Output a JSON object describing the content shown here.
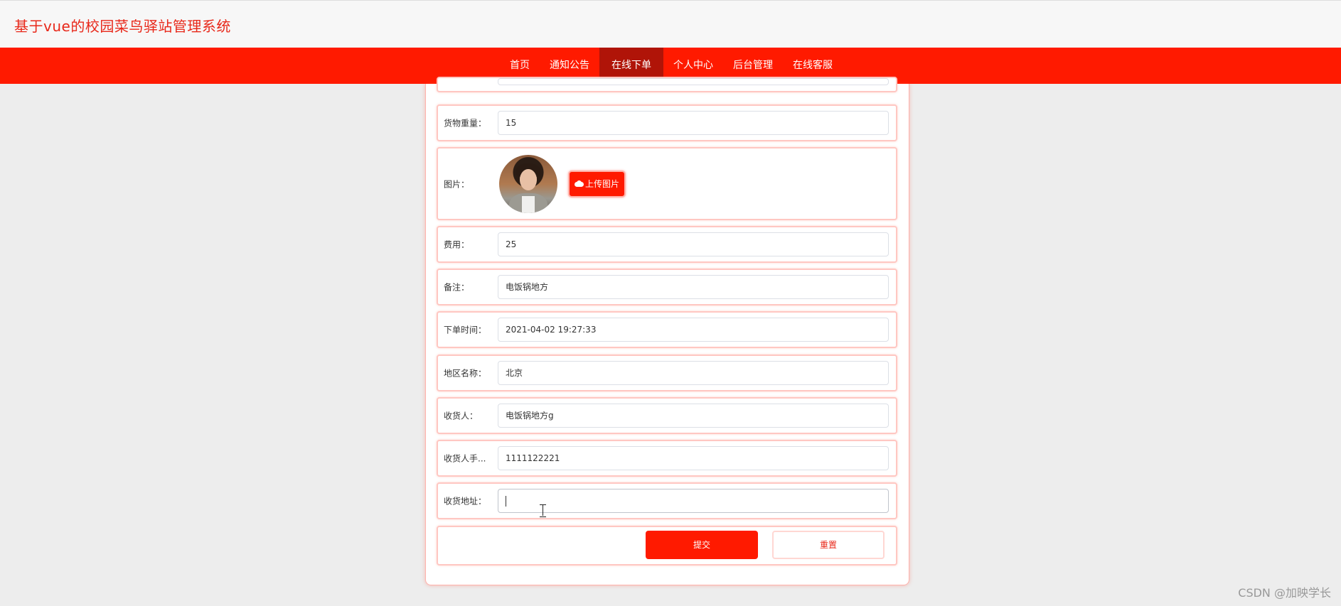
{
  "header": {
    "site_title": "基于vue的校园菜鸟驿站管理系统"
  },
  "nav": {
    "items": [
      {
        "label": "首页"
      },
      {
        "label": "通知公告"
      },
      {
        "label": "在线下单"
      },
      {
        "label": "个人中心"
      },
      {
        "label": "后台管理"
      },
      {
        "label": "在线客服"
      }
    ],
    "active": "在线下单"
  },
  "form": {
    "weight": {
      "label": "货物重量：",
      "value": "15"
    },
    "image": {
      "label": "图片：",
      "upload_label": "上传图片"
    },
    "fee": {
      "label": "费用：",
      "value": "25"
    },
    "remark": {
      "label": "备注：",
      "value": "电饭锅地方"
    },
    "order_time": {
      "label": "下单时间：",
      "value": "2021-04-02 19:27:33"
    },
    "region": {
      "label": "地区名称：",
      "value": "北京"
    },
    "receiver": {
      "label": "收货人：",
      "value": "电饭锅地方g"
    },
    "receiver_phone": {
      "label": "收货人手...",
      "value": "1111122221"
    },
    "address": {
      "label": "收货地址：",
      "value": ""
    },
    "submit_label": "提交",
    "reset_label": "重置"
  },
  "watermark": "CSDN @加映学长",
  "colors": {
    "brand_red": "#ff1a00",
    "active_nav": "#b01408",
    "title_red": "#e8281a"
  }
}
